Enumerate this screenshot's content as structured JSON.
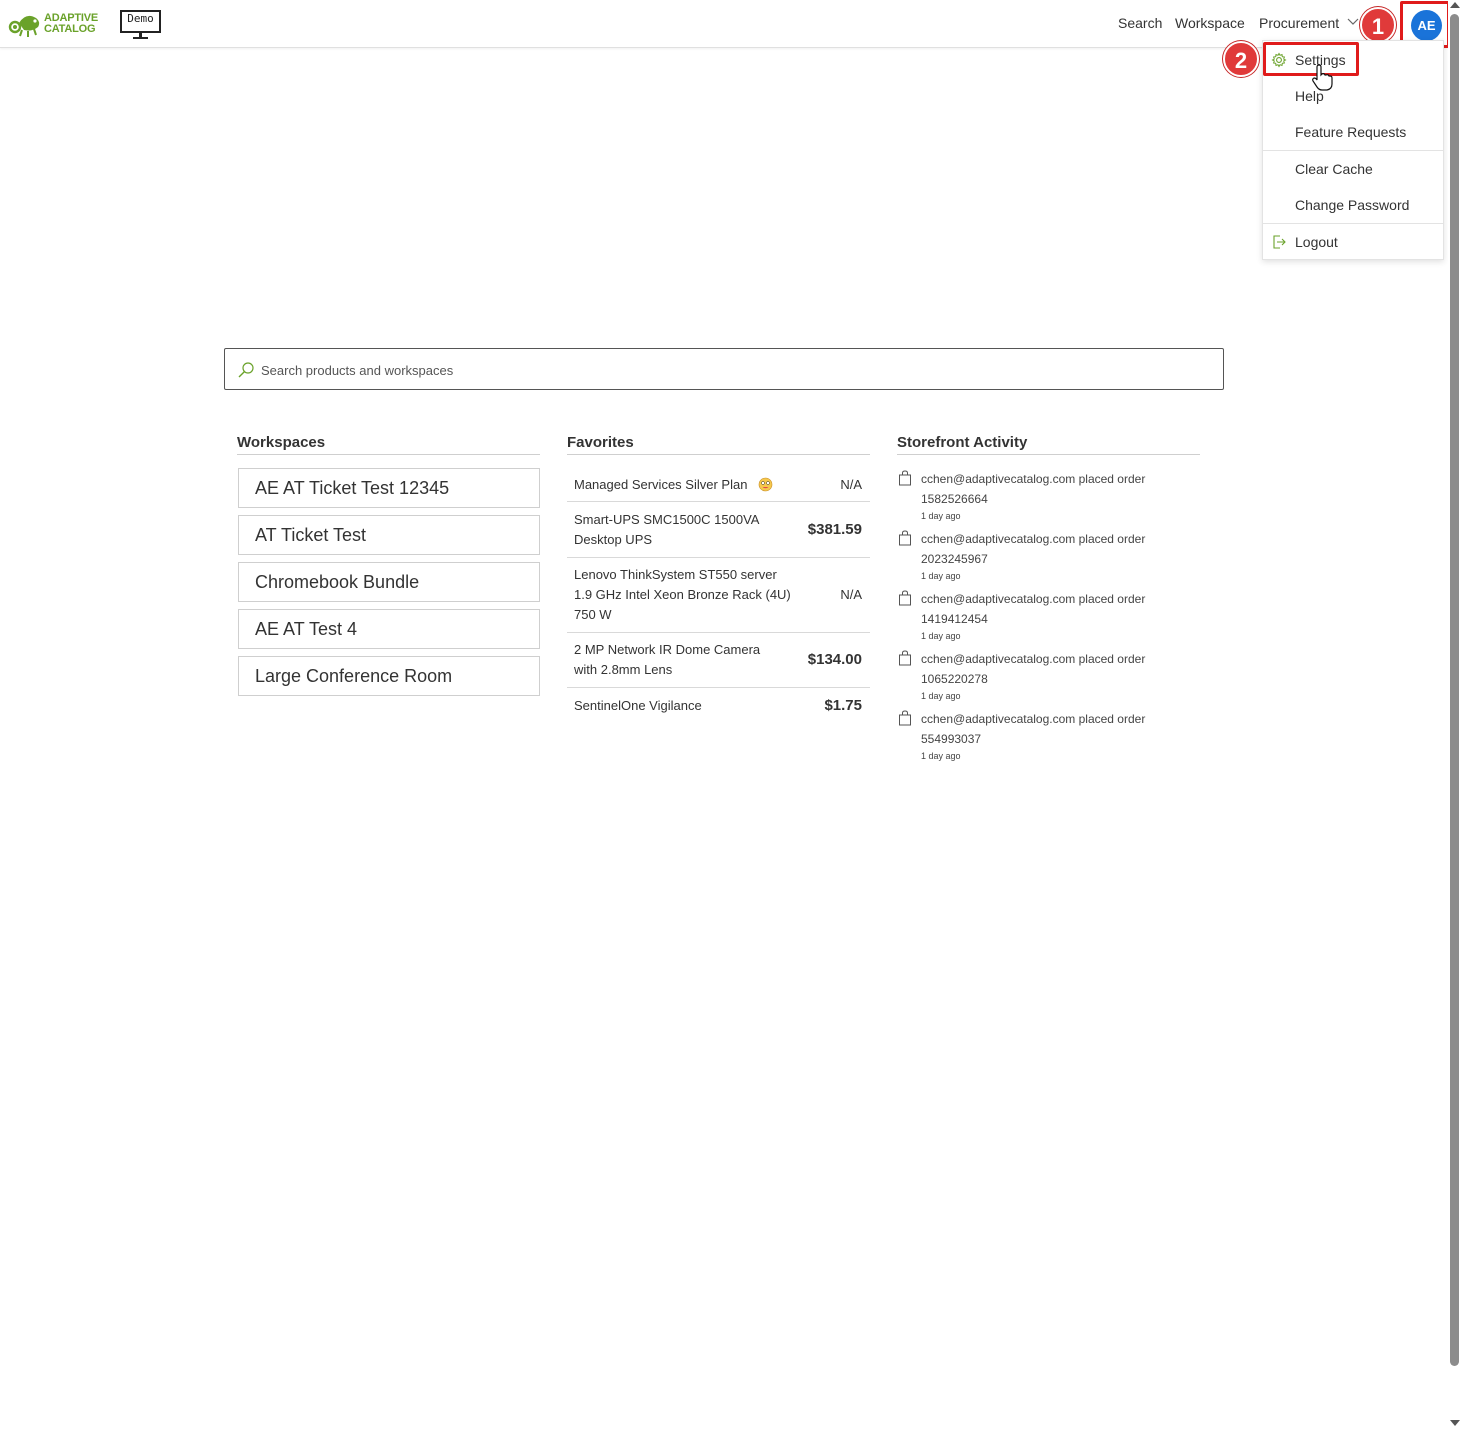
{
  "brand": {
    "logo_line1": "ADAPTIVE",
    "logo_line2": "CATALOG",
    "demo_label": "Demo",
    "accent_color": "#6aa22a"
  },
  "nav": {
    "search": "Search",
    "workspace": "Workspace",
    "procurement": "Procurement",
    "avatar_initials": "AE"
  },
  "markers": {
    "step1": "1",
    "step2": "2"
  },
  "user_menu": {
    "settings": "Settings",
    "help": "Help",
    "feature_requests": "Feature Requests",
    "clear_cache": "Clear Cache",
    "change_password": "Change Password",
    "logout": "Logout"
  },
  "search": {
    "placeholder": "Search products and workspaces"
  },
  "workspaces": {
    "title": "Workspaces",
    "items": [
      "AE AT Ticket Test 12345",
      "AT Ticket Test",
      "Chromebook Bundle",
      "AE AT Test 4",
      "Large Conference Room"
    ]
  },
  "favorites": {
    "title": "Favorites",
    "items": [
      {
        "name": "Managed Services Silver Plan",
        "price": "N/A"
      },
      {
        "name": "Smart-UPS SMC1500C 1500VA Desktop UPS",
        "price": "$381.59"
      },
      {
        "name": "Lenovo ThinkSystem ST550 server 1.9 GHz Intel Xeon Bronze Rack (4U) 750 W",
        "price": "N/A"
      },
      {
        "name": "2 MP Network IR Dome Camera with 2.8mm Lens",
        "price": "$134.00"
      },
      {
        "name": "SentinelOne Vigilance",
        "price": "$1.75"
      }
    ]
  },
  "activity": {
    "title": "Storefront Activity",
    "items": [
      {
        "text": "cchen@adaptivecatalog.com placed order 1582526664",
        "time": "1 day ago"
      },
      {
        "text": "cchen@adaptivecatalog.com placed order 2023245967",
        "time": "1 day ago"
      },
      {
        "text": "cchen@adaptivecatalog.com placed order 1419412454",
        "time": "1 day ago"
      },
      {
        "text": "cchen@adaptivecatalog.com placed order 1065220278",
        "time": "1 day ago"
      },
      {
        "text": "cchen@adaptivecatalog.com placed order 554993037",
        "time": "1 day ago"
      }
    ]
  }
}
